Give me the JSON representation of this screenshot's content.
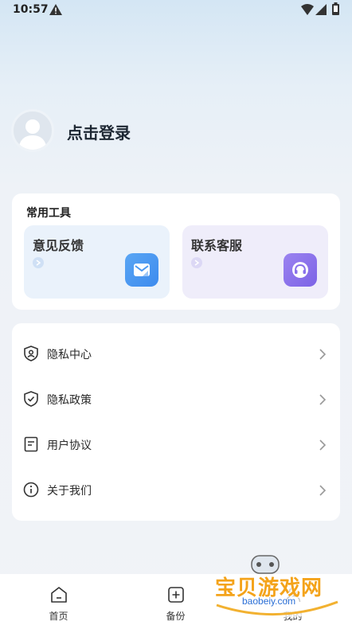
{
  "status_bar": {
    "time": "10:57"
  },
  "profile": {
    "login_label": "点击登录"
  },
  "tools": {
    "title": "常用工具",
    "items": [
      {
        "label": "意见反馈",
        "icon": "mail-icon",
        "color": "#4a98f1"
      },
      {
        "label": "联系客服",
        "icon": "headset-icon",
        "color": "#8a72eb"
      }
    ]
  },
  "menu": {
    "items": [
      {
        "label": "隐私中心",
        "icon": "shield-user-icon"
      },
      {
        "label": "隐私政策",
        "icon": "shield-check-icon"
      },
      {
        "label": "用户协议",
        "icon": "document-icon"
      },
      {
        "label": "关于我们",
        "icon": "info-icon"
      }
    ]
  },
  "bottom_nav": {
    "items": [
      {
        "label": "首页",
        "icon": "home-icon"
      },
      {
        "label": "备份",
        "icon": "add-box-icon"
      },
      {
        "label": "我的",
        "icon": "user-icon"
      }
    ]
  },
  "watermark": {
    "text": "宝贝游戏网",
    "url": "baobeiy.com"
  }
}
